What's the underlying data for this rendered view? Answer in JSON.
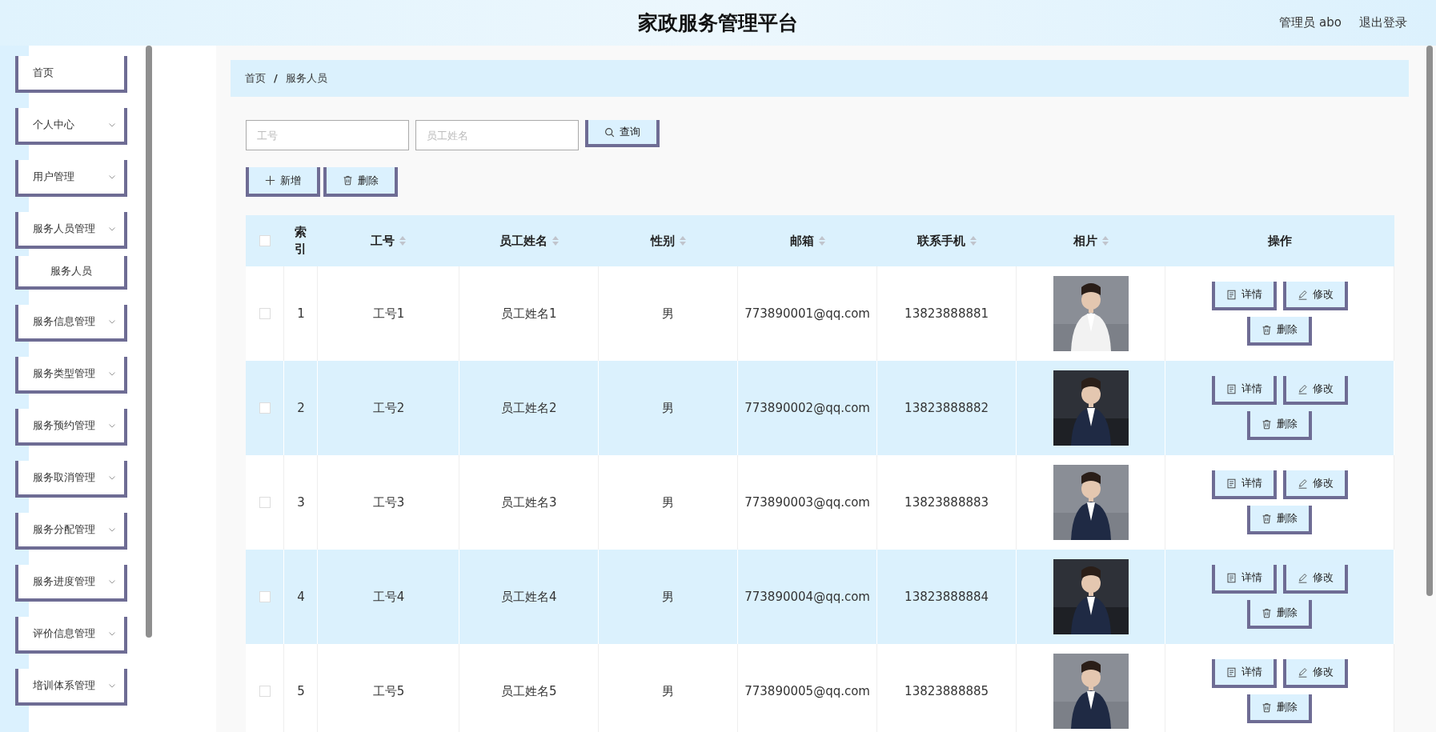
{
  "header": {
    "title": "家政服务管理平台",
    "user": "管理员 abo",
    "logout": "退出登录"
  },
  "sidebar": {
    "items": [
      {
        "label": "首页",
        "expandable": false
      },
      {
        "label": "个人中心",
        "expandable": true
      },
      {
        "label": "用户管理",
        "expandable": true
      },
      {
        "label": "服务人员管理",
        "expandable": true,
        "children": [
          {
            "label": "服务人员"
          }
        ]
      },
      {
        "label": "服务信息管理",
        "expandable": true
      },
      {
        "label": "服务类型管理",
        "expandable": true
      },
      {
        "label": "服务预约管理",
        "expandable": true
      },
      {
        "label": "服务取消管理",
        "expandable": true
      },
      {
        "label": "服务分配管理",
        "expandable": true
      },
      {
        "label": "服务进度管理",
        "expandable": true
      },
      {
        "label": "评价信息管理",
        "expandable": true
      },
      {
        "label": "培训体系管理",
        "expandable": true
      }
    ]
  },
  "breadcrumb": {
    "items": [
      "首页",
      "服务人员"
    ],
    "separator": "/"
  },
  "search": {
    "fields": [
      {
        "placeholder": "工号"
      },
      {
        "placeholder": "员工姓名"
      }
    ],
    "button": "查询"
  },
  "toolbar": [
    {
      "label": "新增",
      "kind": "add"
    },
    {
      "label": "删除",
      "kind": "delete"
    }
  ],
  "table": {
    "select_all_checked": false,
    "columns": [
      {
        "label": "索引",
        "sortable": false
      },
      {
        "label": "工号",
        "sortable": true
      },
      {
        "label": "员工姓名",
        "sortable": true
      },
      {
        "label": "性别",
        "sortable": true
      },
      {
        "label": "邮箱",
        "sortable": true
      },
      {
        "label": "联系手机",
        "sortable": true
      },
      {
        "label": "相片",
        "sortable": true
      },
      {
        "label": "操作",
        "sortable": false
      }
    ],
    "rows": [
      {
        "checked": false,
        "cells": [
          "1",
          "工号1",
          "员工姓名1",
          "男",
          "773890001@qq.com",
          "13823888881"
        ],
        "actions": [
          {
            "label": "详情",
            "kind": "detail"
          },
          {
            "label": "修改",
            "kind": "edit"
          },
          {
            "label": "删除",
            "kind": "delete"
          }
        ]
      },
      {
        "checked": false,
        "cells": [
          "2",
          "工号2",
          "员工姓名2",
          "男",
          "773890002@qq.com",
          "13823888882"
        ],
        "actions": [
          {
            "label": "详情",
            "kind": "detail"
          },
          {
            "label": "修改",
            "kind": "edit"
          },
          {
            "label": "删除",
            "kind": "delete"
          }
        ]
      },
      {
        "checked": false,
        "cells": [
          "3",
          "工号3",
          "员工姓名3",
          "男",
          "773890003@qq.com",
          "13823888883"
        ],
        "actions": [
          {
            "label": "详情",
            "kind": "detail"
          },
          {
            "label": "修改",
            "kind": "edit"
          },
          {
            "label": "删除",
            "kind": "delete"
          }
        ]
      },
      {
        "checked": false,
        "cells": [
          "4",
          "工号4",
          "员工姓名4",
          "男",
          "773890004@qq.com",
          "13823888884"
        ],
        "actions": [
          {
            "label": "详情",
            "kind": "detail"
          },
          {
            "label": "修改",
            "kind": "edit"
          },
          {
            "label": "删除",
            "kind": "delete"
          }
        ]
      },
      {
        "checked": false,
        "cells": [
          "5",
          "工号5",
          "员工姓名5",
          "男",
          "773890005@qq.com",
          "13823888885"
        ],
        "actions": [
          {
            "label": "详情",
            "kind": "detail"
          },
          {
            "label": "修改",
            "kind": "edit"
          },
          {
            "label": "删除",
            "kind": "delete"
          }
        ]
      }
    ]
  }
}
